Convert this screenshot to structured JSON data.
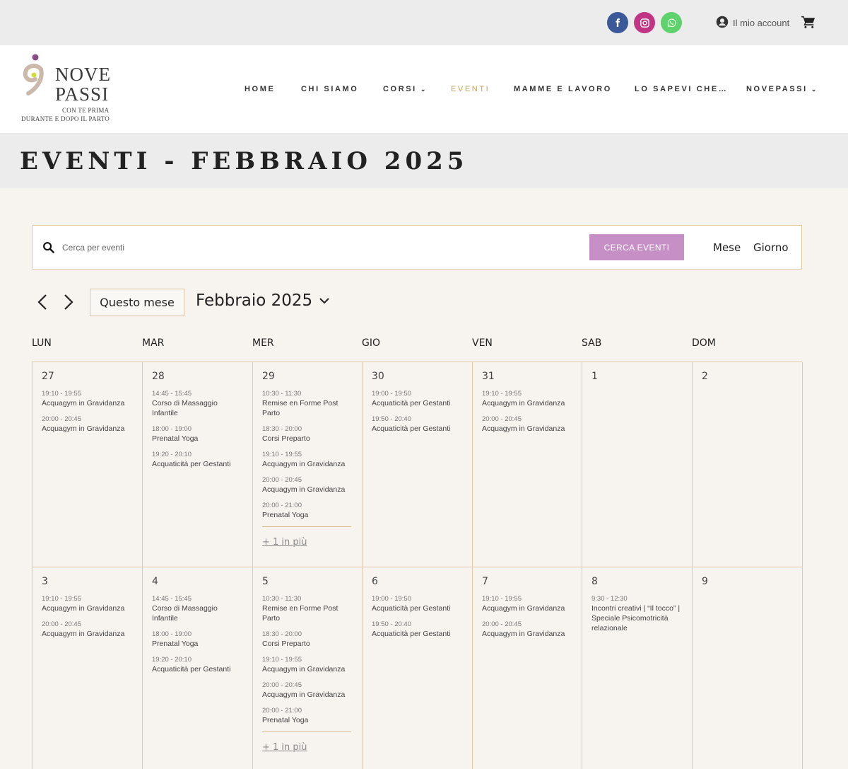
{
  "topbar": {
    "social": [
      {
        "name": "facebook-icon",
        "color": "#3b5998"
      },
      {
        "name": "instagram-icon",
        "color": "#c13584"
      },
      {
        "name": "whatsapp-icon",
        "color": "#5ed36b"
      }
    ],
    "account_label": "Il mio account",
    "cart_icon": "cart-icon"
  },
  "logo": {
    "line1": "NOVE",
    "line2": "PASSI",
    "tagline1": "CON TE PRIMA",
    "tagline2": "DURANTE E DOPO IL PARTO"
  },
  "nav": {
    "items": [
      {
        "label": "HOME",
        "dropdown": false,
        "active": false
      },
      {
        "label": "CHI SIAMO",
        "dropdown": false,
        "active": false
      },
      {
        "label": "CORSI",
        "dropdown": true,
        "active": false
      },
      {
        "label": "EVENTI",
        "dropdown": false,
        "active": true
      },
      {
        "label": "MAMME E LAVORO",
        "dropdown": false,
        "active": false
      },
      {
        "label": "LO SAPEVI CHE…",
        "dropdown": false,
        "active": false
      },
      {
        "label": "NOVEPASSI",
        "dropdown": true,
        "active": false
      }
    ],
    "active_color": "#c9a15a"
  },
  "page_title": "EVENTI - FEBBRAIO 2025",
  "search": {
    "placeholder": "Cerca per eventi",
    "button_label": "CERCA EVENTI",
    "button_color": "#c68fc5",
    "views": [
      "Mese",
      "Giorno"
    ]
  },
  "date_nav": {
    "today_label": "Questo mese",
    "current_month": "Febbraio 2025"
  },
  "calendar": {
    "weekdays": [
      "LUN",
      "MAR",
      "MER",
      "GIO",
      "VEN",
      "SAB",
      "DOM"
    ],
    "weeks": [
      [
        {
          "day": "27",
          "events": [
            {
              "time": "19:10 - 19:55",
              "title": "Acquagym in Gravidanza"
            },
            {
              "time": "20:00 - 20:45",
              "title": "Acquagym in Gravidanza"
            }
          ]
        },
        {
          "day": "28",
          "events": [
            {
              "time": "14:45 - 15:45",
              "title": "Corso di Massaggio Infantile"
            },
            {
              "time": "18:00 - 19:00",
              "title": "Prenatal Yoga"
            },
            {
              "time": "19:20 - 20:10",
              "title": "Acquaticità per Gestanti"
            }
          ]
        },
        {
          "day": "29",
          "events": [
            {
              "time": "10:30 - 11:30",
              "title": "Remise en Forme Post Parto"
            },
            {
              "time": "18:30 - 20:00",
              "title": "Corsi Preparto"
            },
            {
              "time": "19:10 - 19:55",
              "title": "Acquagym in Gravidanza"
            },
            {
              "time": "20:00 - 20:45",
              "title": "Acquagym in Gravidanza"
            },
            {
              "time": "20:00 - 21:00",
              "title": "Prenatal Yoga"
            }
          ],
          "more": "+ 1 in più"
        },
        {
          "day": "30",
          "events": [
            {
              "time": "19:00 - 19:50",
              "title": "Acquaticità per Gestanti"
            },
            {
              "time": "19:50 - 20:40",
              "title": "Acquaticità per Gestanti"
            }
          ]
        },
        {
          "day": "31",
          "events": [
            {
              "time": "19:10 - 19:55",
              "title": "Acquagym in Gravidanza"
            },
            {
              "time": "20:00 - 20:45",
              "title": "Acquagym in Gravidanza"
            }
          ]
        },
        {
          "day": "1",
          "events": []
        },
        {
          "day": "2",
          "events": []
        }
      ],
      [
        {
          "day": "3",
          "events": [
            {
              "time": "19:10 - 19:55",
              "title": "Acquagym in Gravidanza"
            },
            {
              "time": "20:00 - 20:45",
              "title": "Acquagym in Gravidanza"
            }
          ]
        },
        {
          "day": "4",
          "events": [
            {
              "time": "14:45 - 15:45",
              "title": "Corso di Massaggio Infantile"
            },
            {
              "time": "18:00 - 19:00",
              "title": "Prenatal Yoga"
            },
            {
              "time": "19:20 - 20:10",
              "title": "Acquaticità per Gestanti"
            }
          ]
        },
        {
          "day": "5",
          "events": [
            {
              "time": "10:30 - 11:30",
              "title": "Remise en Forme Post Parto"
            },
            {
              "time": "18:30 - 20:00",
              "title": "Corsi Preparto"
            },
            {
              "time": "19:10 - 19:55",
              "title": "Acquagym in Gravidanza"
            },
            {
              "time": "20:00 - 20:45",
              "title": "Acquagym in Gravidanza"
            },
            {
              "time": "20:00 - 21:00",
              "title": "Prenatal Yoga"
            }
          ],
          "more": "+ 1 in più"
        },
        {
          "day": "6",
          "events": [
            {
              "time": "19:00 - 19:50",
              "title": "Acquaticità per Gestanti"
            },
            {
              "time": "19:50 - 20:40",
              "title": "Acquaticità per Gestanti"
            }
          ]
        },
        {
          "day": "7",
          "events": [
            {
              "time": "19:10 - 19:55",
              "title": "Acquagym in Gravidanza"
            },
            {
              "time": "20:00 - 20:45",
              "title": "Acquagym in Gravidanza"
            }
          ]
        },
        {
          "day": "8",
          "events": [
            {
              "time": "9:30 - 12:30",
              "title": "Incontri creativi | “Il tocco” | Speciale Psicomotricità relazionale"
            }
          ]
        },
        {
          "day": "9",
          "events": []
        }
      ]
    ]
  }
}
